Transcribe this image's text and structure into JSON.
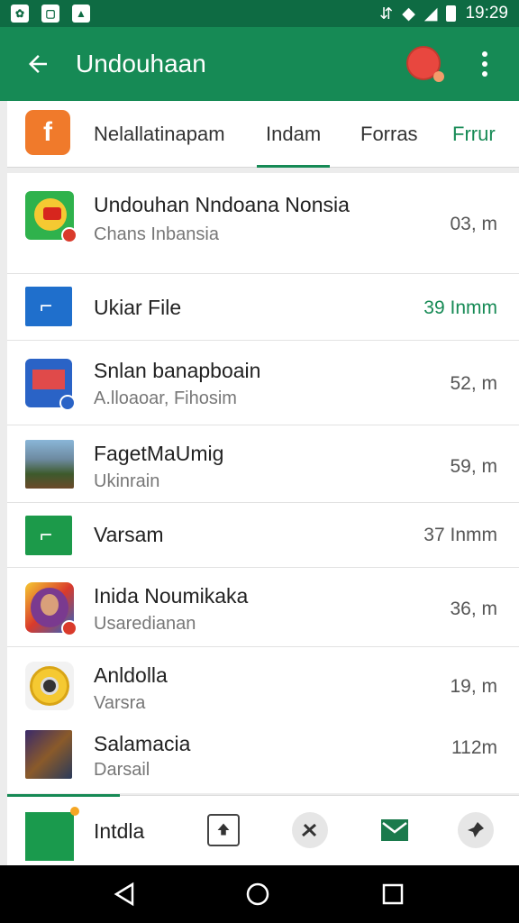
{
  "status_bar": {
    "time": "19:29"
  },
  "app_bar": {
    "title": "Undouhaan"
  },
  "tabs": [
    {
      "label": "Nelallatinapam"
    },
    {
      "label": "Indam"
    },
    {
      "label": "Forras"
    },
    {
      "label": "Frrur"
    }
  ],
  "list": [
    {
      "name": "Undouhan Nndoana Nonsia",
      "sub": "Chans Inbansia",
      "size": "03, m"
    },
    {
      "name": "Ukiar File",
      "sub": "",
      "size": "39 Inmm"
    },
    {
      "name": "Snlan banapboain",
      "sub": "A.lloaoar, Fihosim",
      "size": "52, m"
    },
    {
      "name": "FagetMaUmig",
      "sub": "Ukinrain",
      "size": "59, m"
    },
    {
      "name": "Varsam",
      "sub": "",
      "size": "37 Inmm"
    },
    {
      "name": "Inida Noumikaka",
      "sub": "Usaredianan",
      "size": "36, m"
    },
    {
      "name": "Anldolla",
      "sub": "Varsra",
      "size": "19, m"
    },
    {
      "name": "Salamacia",
      "sub": "Darsail",
      "size": "112m"
    }
  ],
  "bottom_bar": {
    "label": "Intdla",
    "progress_fraction": 0.22
  },
  "colors": {
    "primary": "#168a55",
    "status_bar": "#0e6b43",
    "accent": "#f07a2b"
  }
}
